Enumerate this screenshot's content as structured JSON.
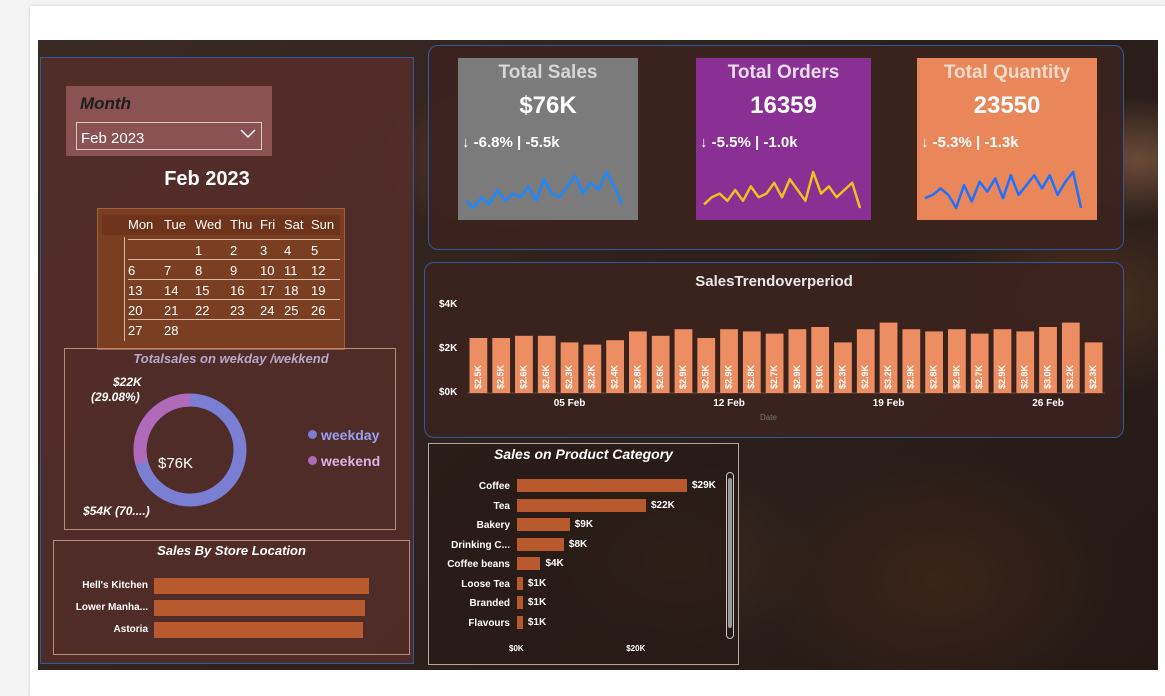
{
  "month_slicer": {
    "label": "Month",
    "selected": "Feb 2023"
  },
  "calendar": {
    "title": "Feb 2023",
    "weekdays": [
      "Mon",
      "Tue",
      "Wed",
      "Thu",
      "Fri",
      "Sat",
      "Sun"
    ],
    "weeks": [
      [
        "",
        "",
        "1",
        "2",
        "3",
        "4",
        "5"
      ],
      [
        "6",
        "7",
        "8",
        "9",
        "10",
        "11",
        "12"
      ],
      [
        "13",
        "14",
        "15",
        "16",
        "17",
        "18",
        "19"
      ],
      [
        "20",
        "21",
        "22",
        "23",
        "24",
        "25",
        "26"
      ],
      [
        "27",
        "28",
        "",
        "",
        "",
        "",
        ""
      ]
    ]
  },
  "kpis": [
    {
      "title": "Total Sales",
      "value": "$76K",
      "delta": "↓ -6.8% | -5.5k",
      "bg": "#7b7b7b",
      "title_color": "#d6d6d6",
      "spark_color": "#1e88ff",
      "spark": [
        5,
        3,
        6,
        4,
        8,
        5,
        7,
        6,
        9,
        5,
        11,
        7,
        6,
        9,
        12,
        7,
        10,
        8,
        13,
        9,
        4
      ]
    },
    {
      "title": "Total Orders",
      "value": "16359",
      "delta": "↓ -5.5% | -1.0k",
      "bg": "#8a2f94",
      "title_color": "#e8dcea",
      "spark_color": "#f0c020",
      "spark": [
        5,
        7,
        8,
        6,
        9,
        6,
        10,
        7,
        8,
        11,
        7,
        12,
        9,
        6,
        14,
        8,
        10,
        7,
        9,
        11,
        4
      ]
    },
    {
      "title": "Total Quantity",
      "value": "23550",
      "delta": "↓ -5.3% | -1.3k",
      "bg": "#e9875a",
      "title_color": "#f6dccd",
      "spark_color": "#1e70ff",
      "spark": [
        5,
        6,
        8,
        6,
        2,
        9,
        4,
        10,
        7,
        11,
        5,
        12,
        6,
        9,
        12,
        8,
        12,
        6,
        10,
        13,
        2
      ]
    }
  ],
  "weekday_weekend": {
    "title": "Totalsales on wekday /wekkend",
    "center": "$76K",
    "weekend_label": "$22K",
    "weekend_pct": "(29.08%)",
    "weekday_label": "$54K (70....)",
    "legend": [
      {
        "name": "weekday",
        "color": "#7a7fd4"
      },
      {
        "name": "weekend",
        "color": "#b06aba"
      }
    ],
    "weekend_share": 0.2908
  },
  "store": {
    "title": "Sales By Store Location",
    "items": [
      {
        "name": "Hell's Kitchen",
        "value": 26
      },
      {
        "name": "Lower Manha...",
        "value": 25.5
      },
      {
        "name": "Astoria",
        "value": 25.3
      }
    ]
  },
  "chart_data": [
    {
      "type": "bar",
      "title": "SalesTrendoverperiod",
      "xlabel": "Date",
      "ylabel": "",
      "ylim": [
        0,
        4
      ],
      "y_ticks": [
        "$0K",
        "$2K",
        "$4K"
      ],
      "x_ticks": [
        {
          "label": "05 Feb",
          "index": 4
        },
        {
          "label": "12 Feb",
          "index": 11
        },
        {
          "label": "19 Feb",
          "index": 18
        },
        {
          "label": "26 Feb",
          "index": 25
        }
      ],
      "categories": [
        "1",
        "2",
        "3",
        "4",
        "5",
        "6",
        "7",
        "8",
        "9",
        "10",
        "11",
        "12",
        "13",
        "14",
        "15",
        "16",
        "17",
        "18",
        "19",
        "20",
        "21",
        "22",
        "23",
        "24",
        "25",
        "26",
        "27",
        "28"
      ],
      "values": [
        2.5,
        2.5,
        2.6,
        2.6,
        2.3,
        2.2,
        2.4,
        2.8,
        2.6,
        2.9,
        2.5,
        2.9,
        2.8,
        2.7,
        2.9,
        3.0,
        2.3,
        2.9,
        3.2,
        2.9,
        2.8,
        2.9,
        2.7,
        2.9,
        2.8,
        3.0,
        3.2,
        2.3
      ],
      "value_labels": [
        "$2.5K",
        "$2.5K",
        "$2.6K",
        "$2.6K",
        "$2.3K",
        "$2.2K",
        "$2.4K",
        "$2.8K",
        "$2.6K",
        "$2.9K",
        "$2.5K",
        "$2.9K",
        "$2.8K",
        "$2.7K",
        "$2.9K",
        "$3.0K",
        "$2.3K",
        "$2.9K",
        "$3.2K",
        "$2.9K",
        "$2.8K",
        "$2.9K",
        "$2.7K",
        "$2.9K",
        "$2.8K",
        "$3.0K",
        "$3.2K",
        "$2.3K"
      ]
    },
    {
      "type": "bar",
      "title": "Sales on Product Category",
      "categories": [
        "Coffee",
        "Tea",
        "Bakery",
        "Drinking C...",
        "Coffee beans",
        "Loose Tea",
        "Branded",
        "Flavours"
      ],
      "values": [
        29,
        22,
        9,
        8,
        4,
        1,
        1,
        1
      ],
      "value_labels": [
        "$29K",
        "$22K",
        "$9K",
        "$8K",
        "$4K",
        "$1K",
        "$1K",
        "$1K"
      ],
      "x_ticks": [
        "$0K",
        "$20K"
      ]
    }
  ]
}
